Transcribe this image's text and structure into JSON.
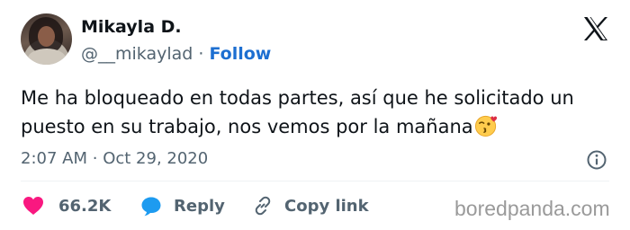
{
  "author": {
    "name": "Mikayla D.",
    "handle": "@__mikaylad",
    "separator": "·",
    "follow_label": "Follow"
  },
  "tweet": {
    "text": "Me ha bloqueado en todas partes, así que he solicitado un puesto en su trabajo, nos vemos por la mañana",
    "emoji_icon": "kissing-face-with-heart-emoji",
    "time": "2:07 AM",
    "separator": "·",
    "date": "Oct 29, 2020"
  },
  "actions": {
    "likes": "66.2K",
    "reply_label": "Reply",
    "copy_link_label": "Copy link"
  },
  "watermark": "boredpanda.com",
  "colors": {
    "text": "#0f1419",
    "secondary": "#536471",
    "follow": "#1d6fd1",
    "heart": "#f91880",
    "reply_bubble": "#1d9bf0",
    "divider": "#eff3f4"
  }
}
